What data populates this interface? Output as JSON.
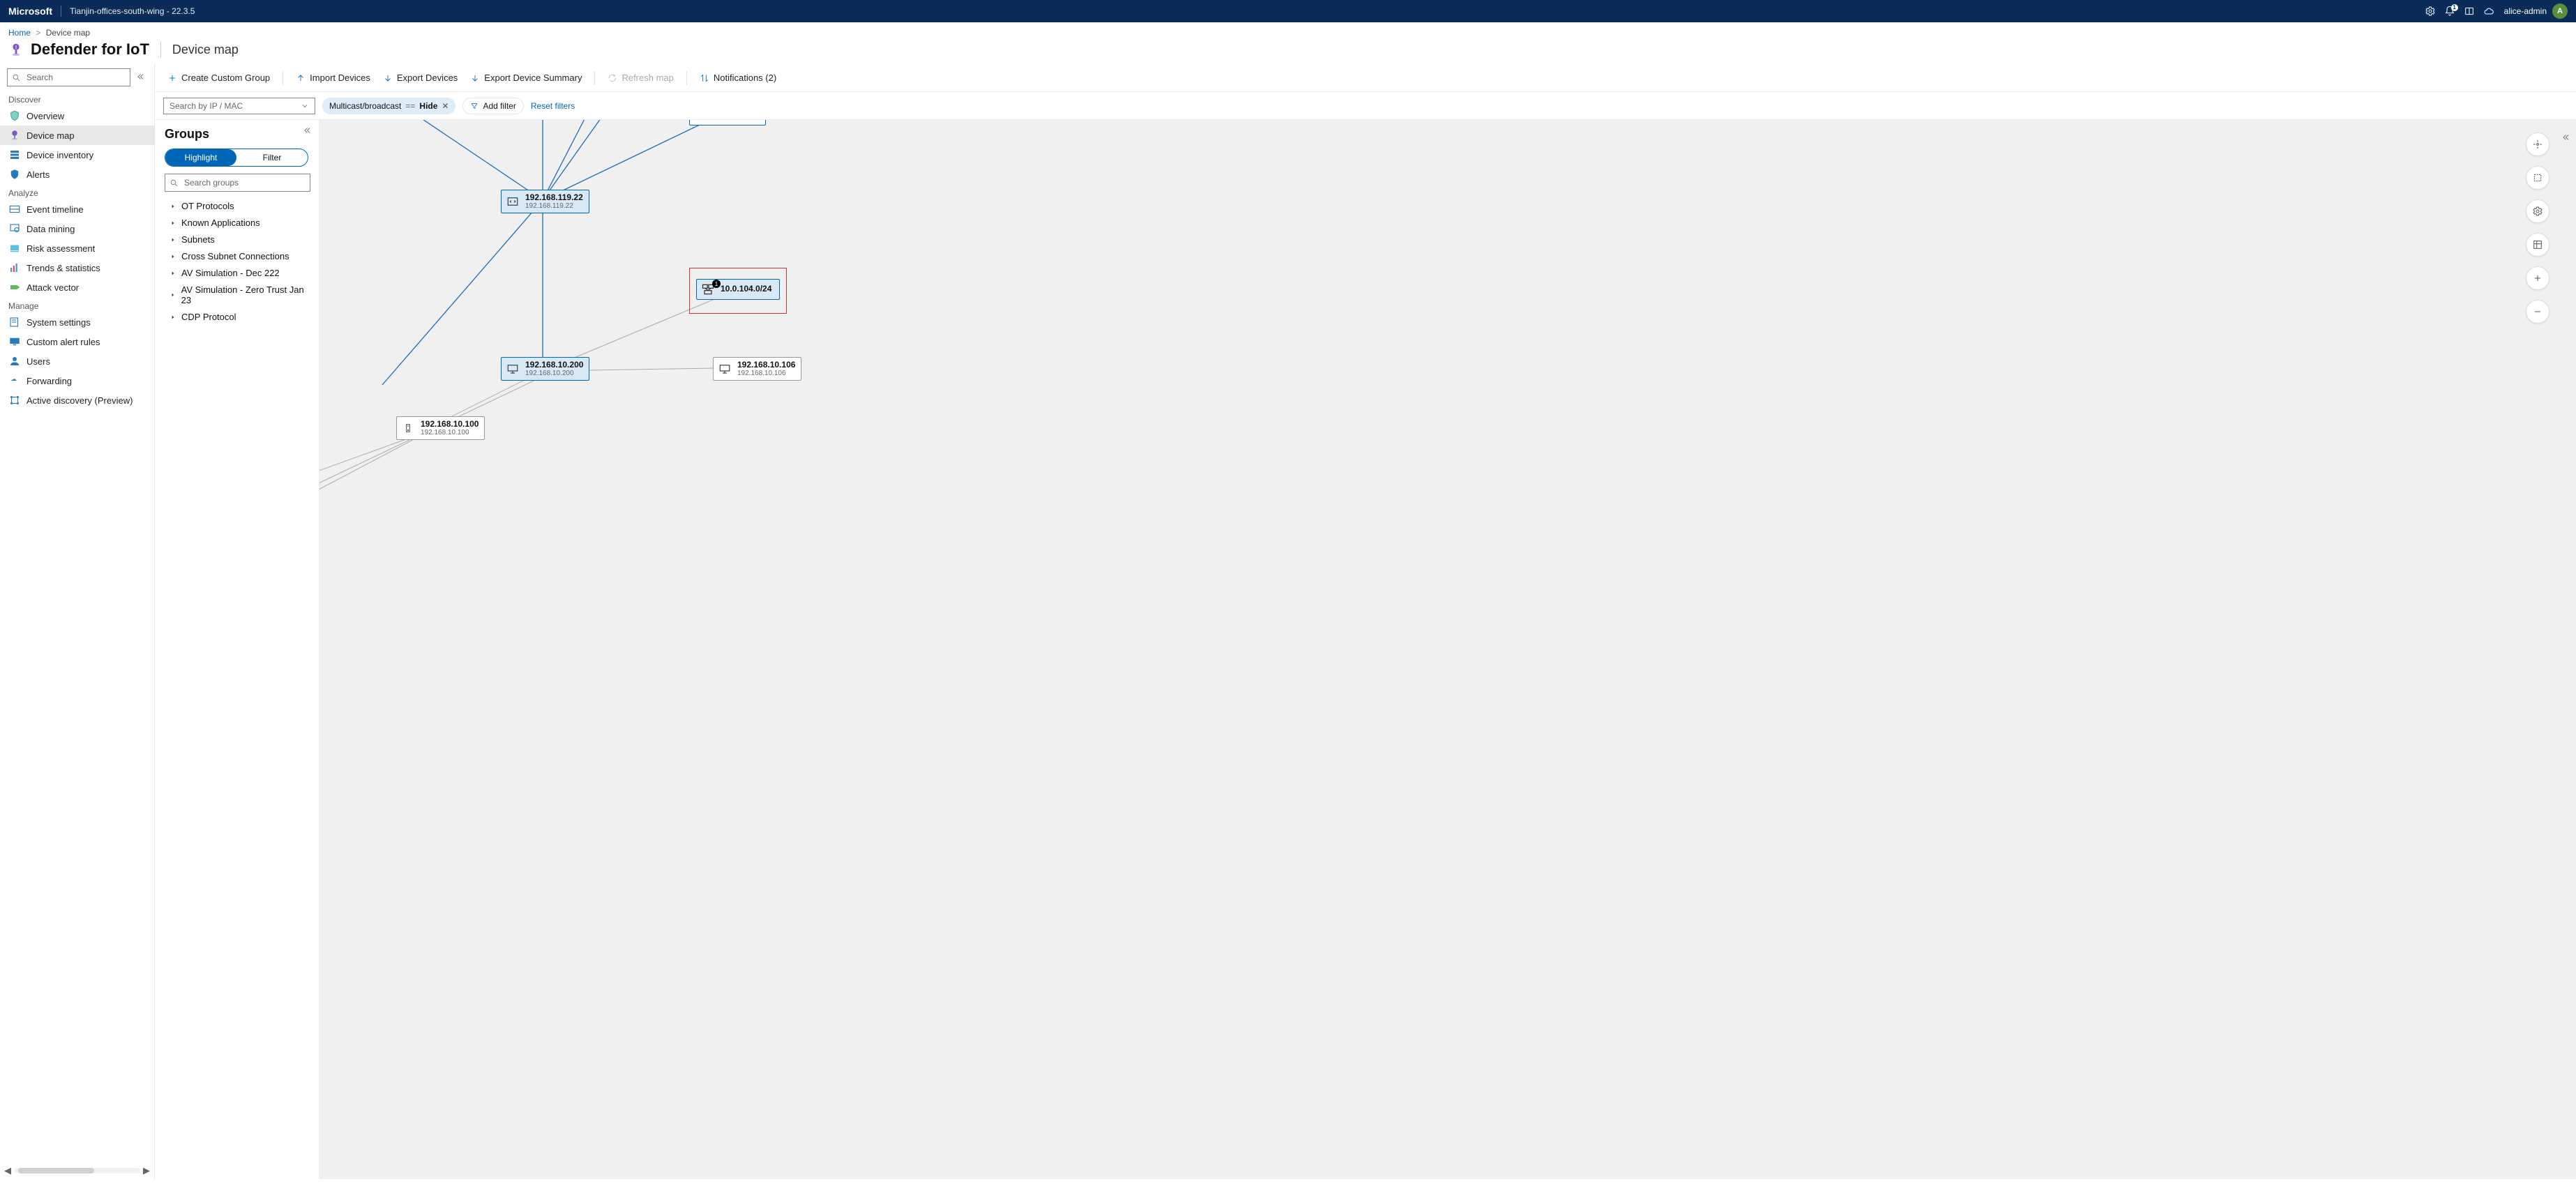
{
  "header": {
    "brand": "Microsoft",
    "tenant_name": "Tianjin-offices-south-wing",
    "tenant_version": "22.3.5",
    "notification_count": "1",
    "username": "alice-admin",
    "avatar_initial": "A"
  },
  "breadcrumb": {
    "home": "Home",
    "current": "Device map"
  },
  "title": {
    "product": "Defender for IoT",
    "page": "Device map"
  },
  "leftnav": {
    "search_placeholder": "Search",
    "sections": {
      "discover": "Discover",
      "analyze": "Analyze",
      "manage": "Manage"
    },
    "items": {
      "overview": "Overview",
      "device_map": "Device map",
      "device_inventory": "Device inventory",
      "alerts": "Alerts",
      "event_timeline": "Event timeline",
      "data_mining": "Data mining",
      "risk_assessment": "Risk assessment",
      "trends_stats": "Trends & statistics",
      "attack_vector": "Attack vector",
      "system_settings": "System settings",
      "custom_alert_rules": "Custom alert rules",
      "users": "Users",
      "forwarding": "Forwarding",
      "active_discovery": "Active discovery (Preview)"
    }
  },
  "toolbar": {
    "create_group": "Create Custom Group",
    "import_devices": "Import Devices",
    "export_devices": "Export Devices",
    "export_summary": "Export Device Summary",
    "refresh_map": "Refresh map",
    "notifications": "Notifications (2)"
  },
  "filters": {
    "ip_placeholder": "Search by IP / MAC",
    "pill_label": "Multicast/broadcast",
    "pill_op": "==",
    "pill_value": "Hide",
    "add_filter": "Add filter",
    "reset": "Reset filters"
  },
  "groups": {
    "title": "Groups",
    "seg_highlight": "Highlight",
    "seg_filter": "Filter",
    "search_placeholder": "Search groups",
    "items": [
      "OT Protocols",
      "Known Applications",
      "Subnets",
      "Cross Subnet Connections",
      "AV Simulation - Dec 222",
      "AV Simulation - Zero Trust Jan 23",
      "CDP Protocol"
    ]
  },
  "nodes": {
    "n1": {
      "l1": "192.168.119.22",
      "l2": "192.168.119.22"
    },
    "n2": {
      "l1": "10.0.104.0/24",
      "badge": "1"
    },
    "n3": {
      "l1": "192.168.10.200",
      "l2": "192.168.10.200"
    },
    "n4": {
      "l1": "192.168.10.106",
      "l2": "192.168.10.106"
    },
    "n5": {
      "l1": "192.168.10.100",
      "l2": "192.168.10.100"
    }
  }
}
